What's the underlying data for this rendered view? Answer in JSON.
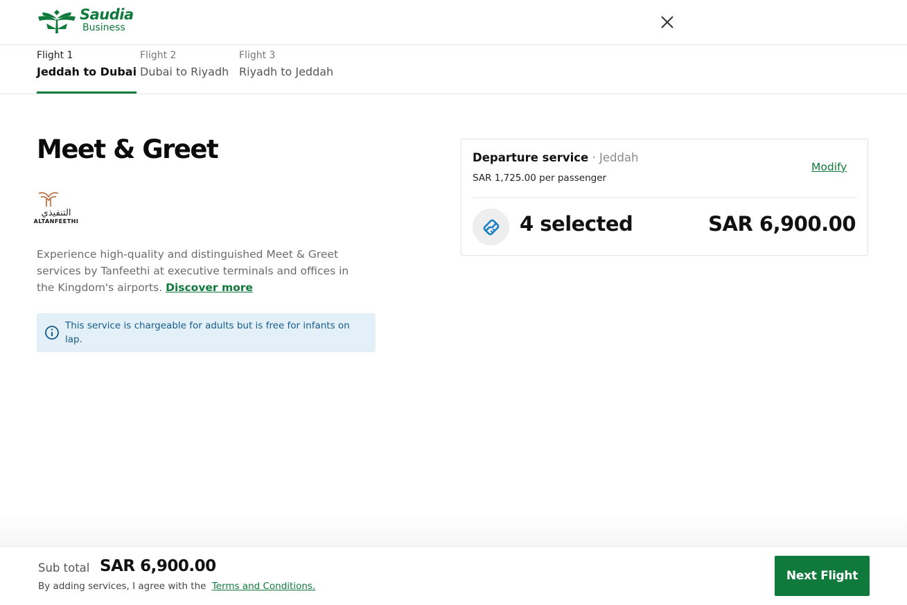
{
  "header": {
    "logo_name": "Saudia",
    "logo_sub": "Business",
    "close_icon": "close-icon"
  },
  "tabs": [
    {
      "label": "Flight 1",
      "route": "Jeddah to Dubai",
      "active": true
    },
    {
      "label": "Flight 2",
      "route": "Dubai to Riyadh",
      "active": false
    },
    {
      "label": "Flight 3",
      "route": "Riyadh to Jeddah",
      "active": false
    }
  ],
  "main": {
    "title": "Meet & Greet",
    "partner_ar": "التنفيذي",
    "partner_en": "ALTANFEETHI",
    "description": "Experience high-quality and distinguished Meet & Greet services by Tanfeethi at executive terminals and offices in the Kingdom's airports.",
    "discover_link": "Discover more",
    "info": "This service is chargeable for adults but is free for infants on lap."
  },
  "card": {
    "service": "Departure service",
    "separator": " · ",
    "location": "Jeddah",
    "price": "SAR 1,725.00 per passenger",
    "modify": "Modify",
    "selected": "4 selected",
    "total": "SAR 6,900.00"
  },
  "footer": {
    "subtotal_label": "Sub total",
    "subtotal_value": "SAR 6,900.00",
    "terms_prefix": "By adding services, I agree with the",
    "terms_link": "Terms and Conditions.",
    "next_button": "Next Flight"
  },
  "colors": {
    "brand_green": "#0f7a3b",
    "info_bg": "#e3f0f8",
    "info_text": "#145b8c",
    "icon_blue": "#1a7fc1",
    "partner_copper": "#b5653a"
  }
}
